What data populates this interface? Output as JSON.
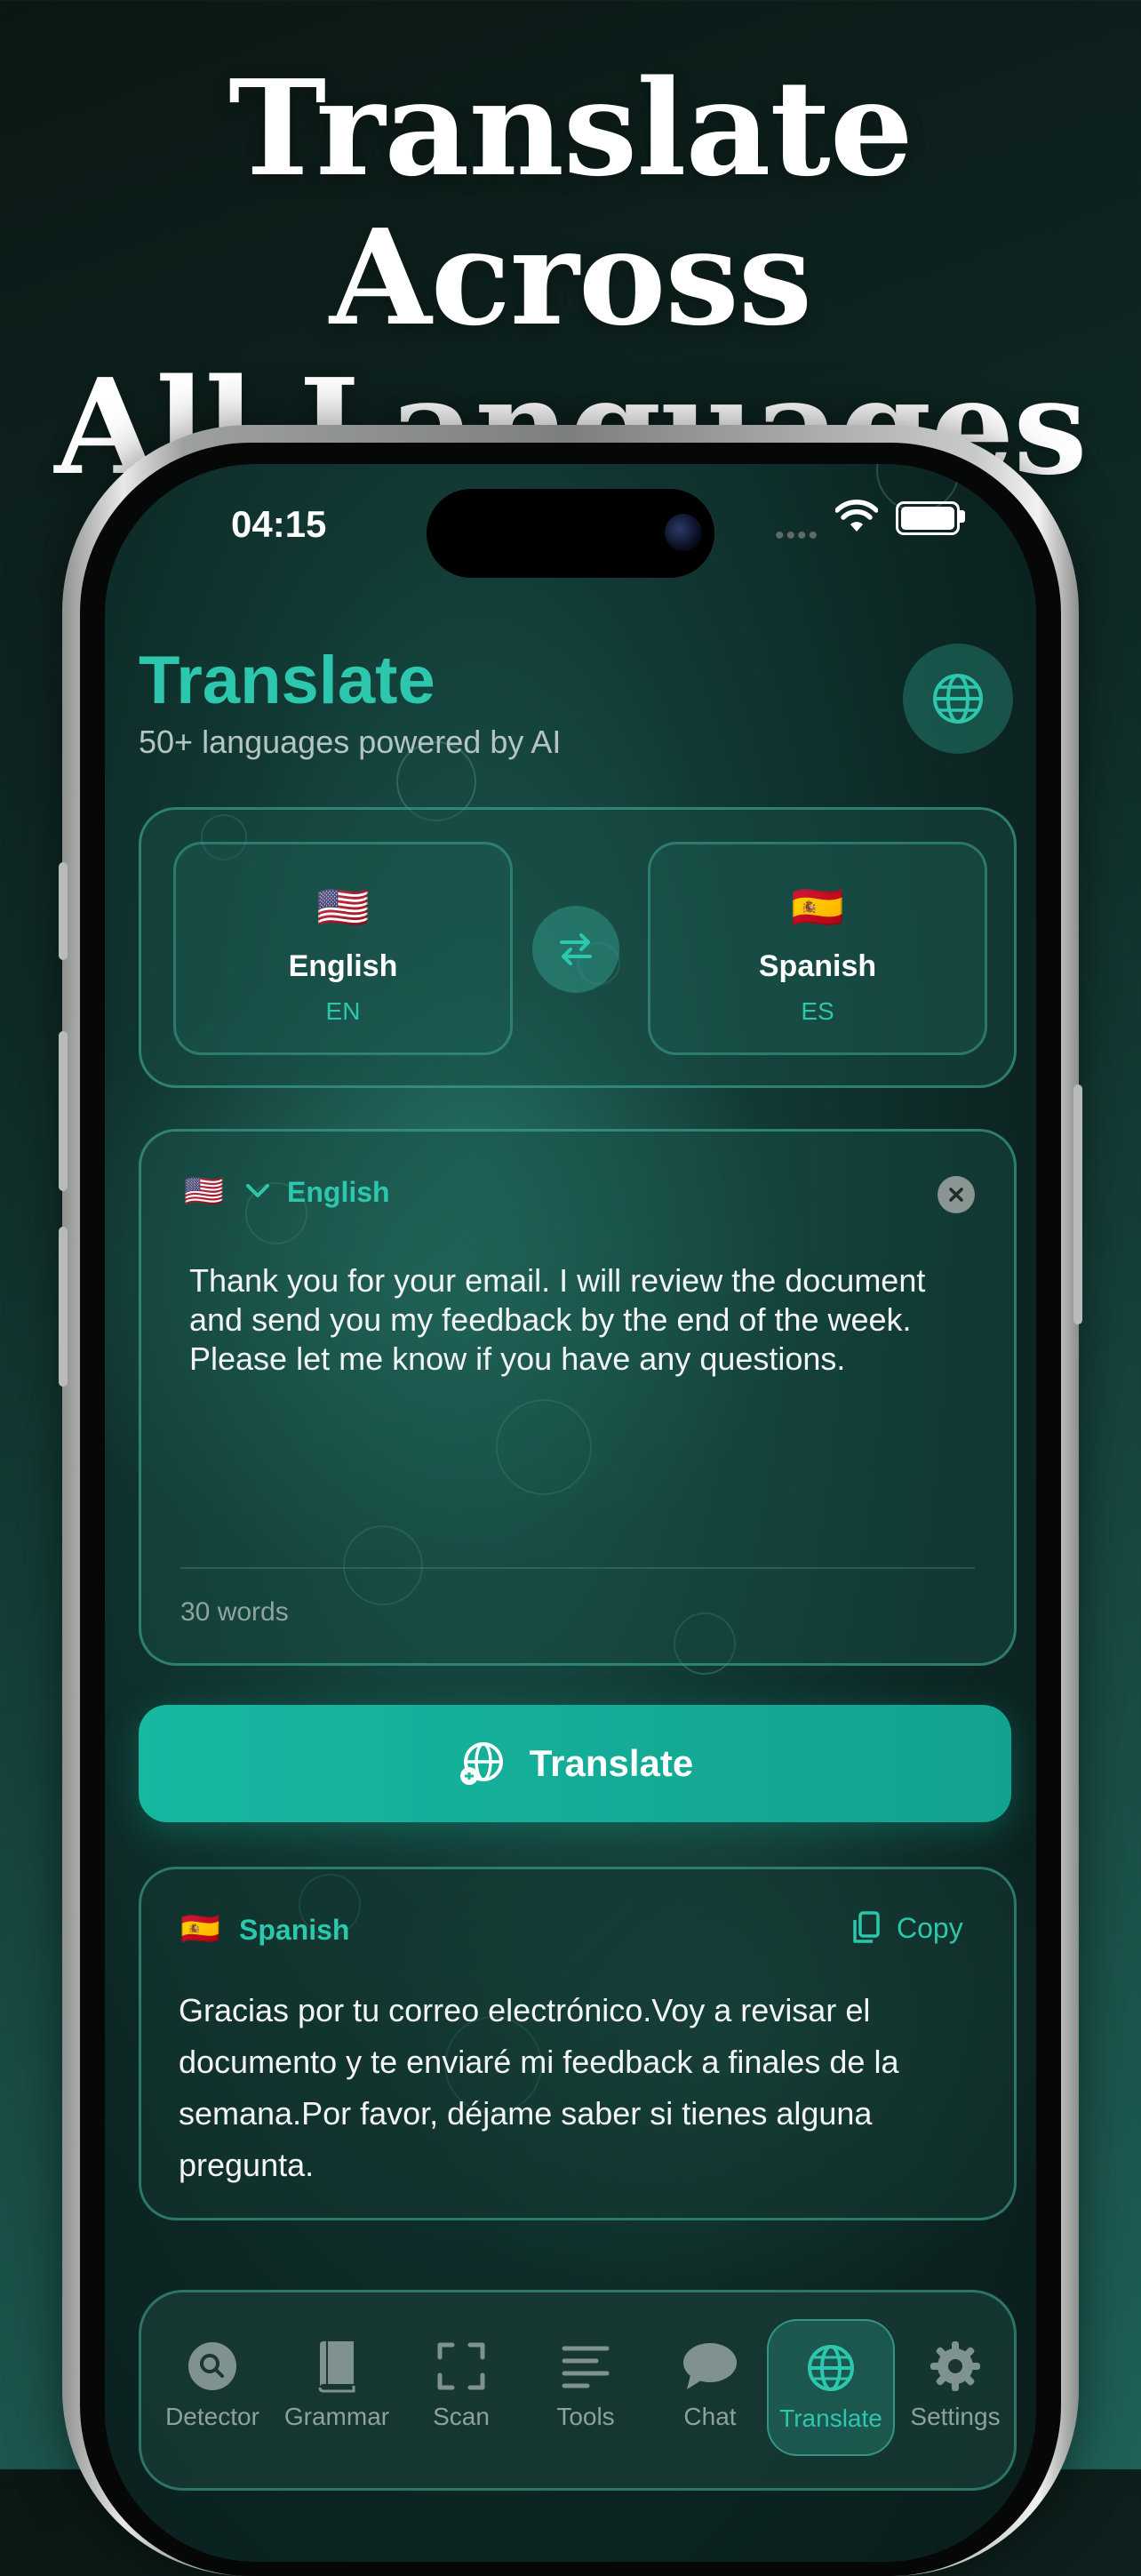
{
  "headline": {
    "line1": "Translate Across",
    "line2": "All Languages"
  },
  "status_bar": {
    "time": "04:15",
    "signal": "••••"
  },
  "header": {
    "title": "Translate",
    "subtitle": "50+ languages powered by AI",
    "globe_icon": "globe-icon"
  },
  "languages": {
    "source": {
      "flag": "🇺🇸",
      "name": "English",
      "code": "EN"
    },
    "target": {
      "flag": "🇪🇸",
      "name": "Spanish",
      "code": "ES"
    },
    "swap_icon": "swap-arrows-icon"
  },
  "input": {
    "flag": "🇺🇸",
    "language": "English",
    "text": "Thank you for your email. I will review the document and send you my feedback by the end of the week. Please let me know if you have any questions.",
    "word_count": "30 words"
  },
  "translate_button": {
    "label": "Translate"
  },
  "output": {
    "flag": "🇪🇸",
    "language": "Spanish",
    "copy_label": "Copy",
    "text": "Gracias por tu correo electrónico.Voy a revisar el documento y te enviaré mi feedback a finales de la semana.Por favor, déjame saber si tienes alguna pregunta."
  },
  "tabs": [
    {
      "label": "Detector",
      "icon": "search-icon"
    },
    {
      "label": "Grammar",
      "icon": "book-icon"
    },
    {
      "label": "Scan",
      "icon": "scan-icon"
    },
    {
      "label": "Tools",
      "icon": "lines-icon"
    },
    {
      "label": "Chat",
      "icon": "chat-bubble-icon"
    },
    {
      "label": "Translate",
      "icon": "globe-icon",
      "active": true
    },
    {
      "label": "Settings",
      "icon": "gear-icon"
    }
  ],
  "colors": {
    "accent": "#2cc7ad",
    "button": "#17b7a0",
    "background": "#0f2a26"
  }
}
